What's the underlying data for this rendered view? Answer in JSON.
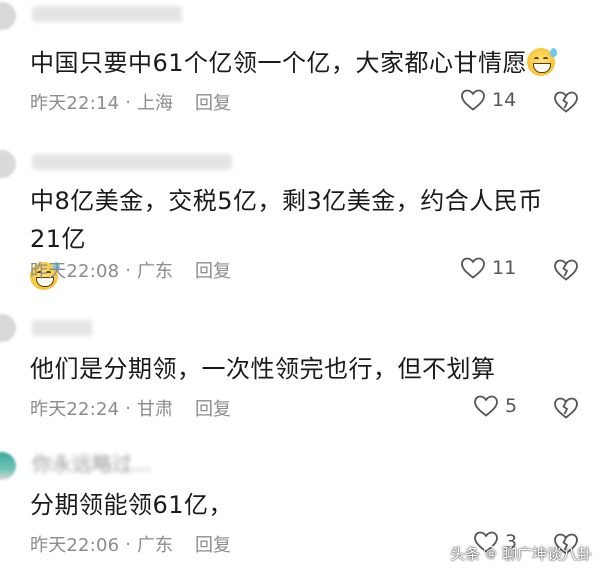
{
  "comments": [
    {
      "username": "",
      "text": "中国只要中61个亿领一个亿，大家都心甘情愿",
      "emoji": "grin-sweat",
      "time": "昨天22:14",
      "sep": "·",
      "location": "上海",
      "reply_label": "回复",
      "likes": "14"
    },
    {
      "username": "",
      "text": "中8亿美金，交税5亿，剩3亿美金，约合人民币21亿",
      "emoji": "grin-sweat",
      "time": "昨天22:08",
      "sep": "·",
      "location": "广东",
      "reply_label": "回复",
      "likes": "11"
    },
    {
      "username": "",
      "text": "他们是分期领，一次性领完也行，但不划算",
      "time": "昨天22:24",
      "sep": "·",
      "location": "甘肃",
      "reply_label": "回复",
      "likes": "5"
    },
    {
      "username": "你永远略过...",
      "text": "分期领能领61亿，",
      "time": "昨天22:06",
      "sep": "·",
      "location": "广东",
      "reply_label": "回复",
      "likes": "3"
    }
  ],
  "watermark": {
    "prefix": "头条",
    "handle": "聊广坤谈八卦"
  },
  "colors": {
    "text": "#1a1a1a",
    "meta": "#8c8c8c",
    "background": "#ffffff"
  },
  "icons": {
    "like": "heart-outline-icon",
    "dislike": "broken-heart-icon",
    "emoji": "grinning-sweat-emoji-icon"
  }
}
